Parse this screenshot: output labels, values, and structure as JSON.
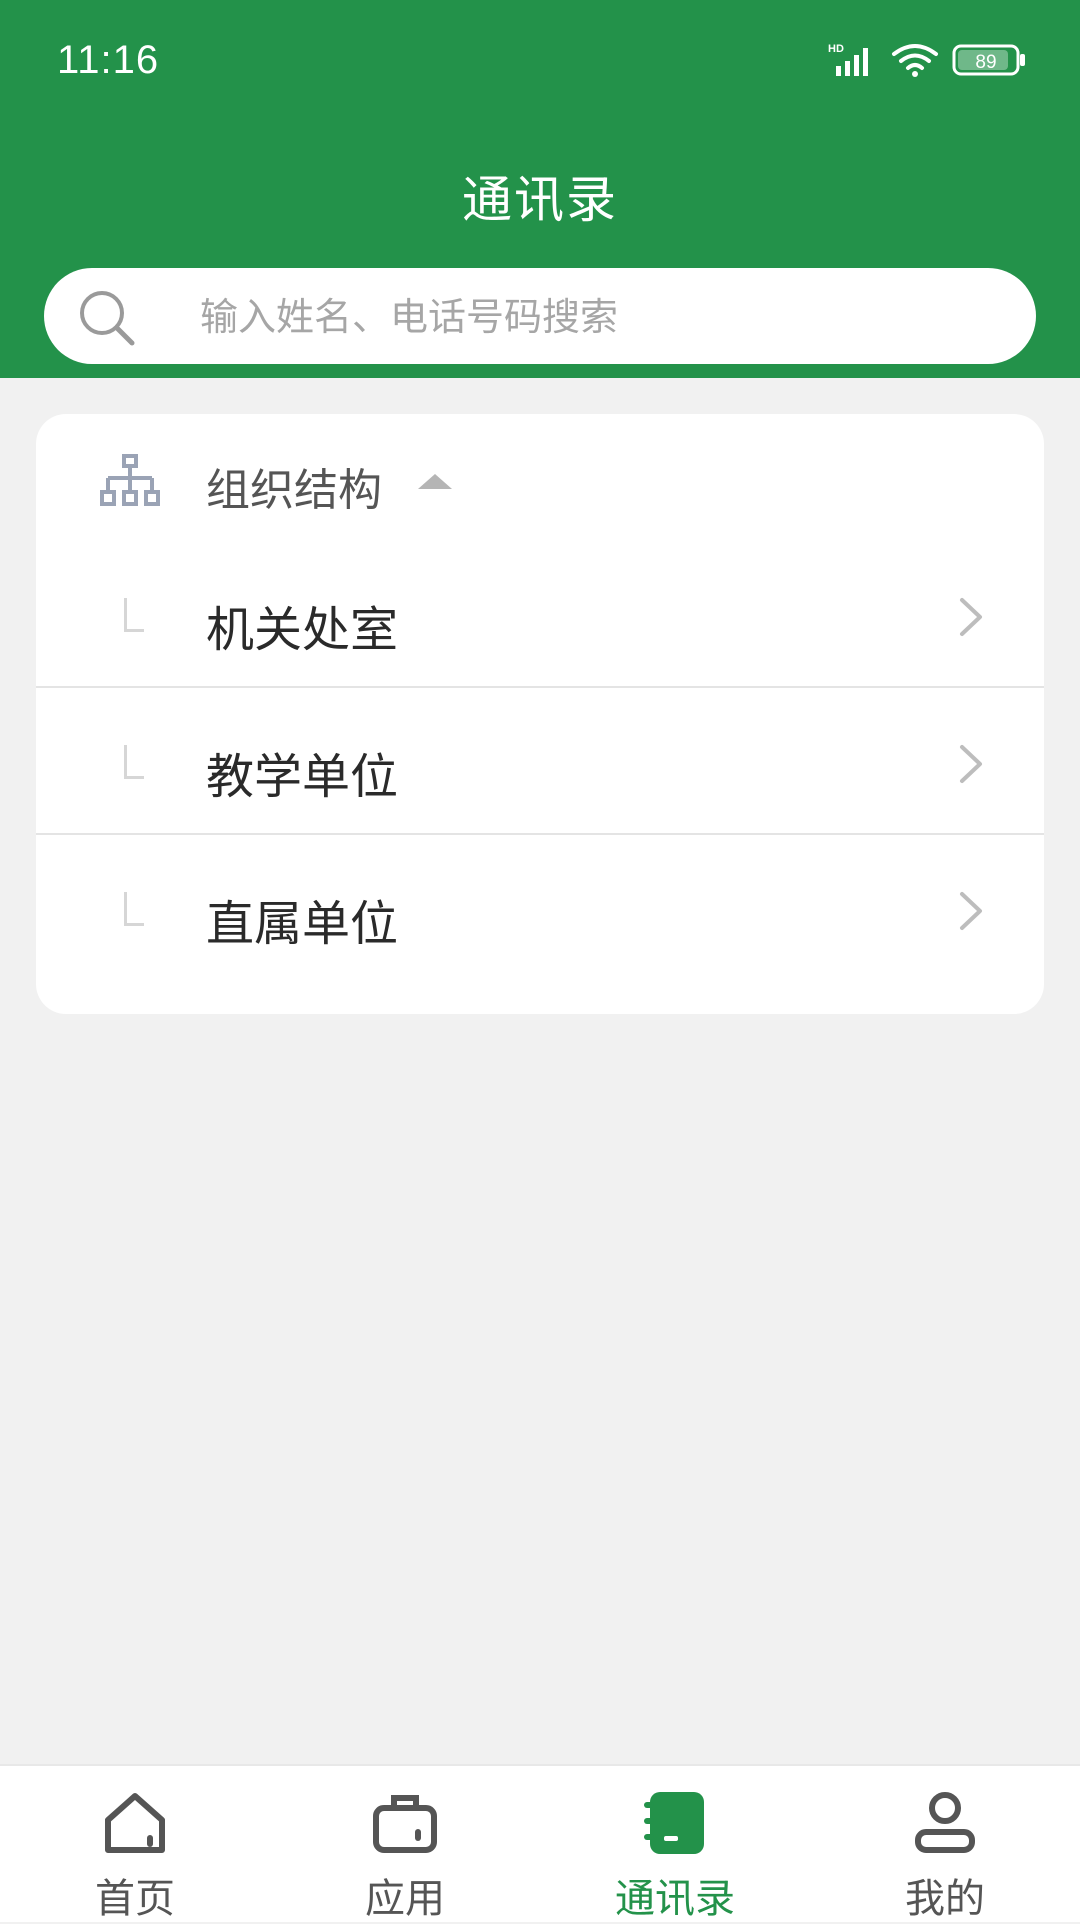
{
  "status_bar": {
    "time": "11:16",
    "battery": "89",
    "network": "HD"
  },
  "header": {
    "title": "通讯录"
  },
  "search": {
    "placeholder": "输入姓名、电话号码搜索"
  },
  "org": {
    "label": "组织结构",
    "items": [
      {
        "label": "机关处室"
      },
      {
        "label": "教学单位"
      },
      {
        "label": "直属单位"
      }
    ]
  },
  "tabbar": {
    "items": [
      {
        "label": "首页",
        "icon": "home-icon"
      },
      {
        "label": "应用",
        "icon": "briefcase-icon"
      },
      {
        "label": "通讯录",
        "icon": "contacts-book-icon",
        "active": true
      },
      {
        "label": "我的",
        "icon": "user-icon"
      }
    ]
  },
  "colors": {
    "primary": "#23924a",
    "background": "#f1f1f1",
    "inactive_icon": "#555555"
  }
}
